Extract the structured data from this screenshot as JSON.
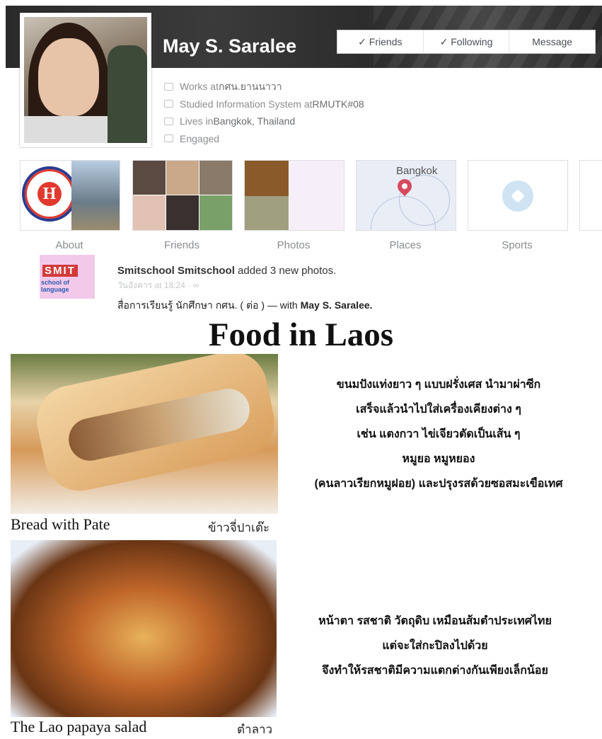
{
  "profile": {
    "name": "May S. Saralee",
    "buttons": {
      "friends": "✓ Friends",
      "following": "✓ Following",
      "message": "Message"
    },
    "info": [
      {
        "prefix": "Works at ",
        "value": "กศน.ยานนาวา"
      },
      {
        "prefix": "Studied Information System at ",
        "value": "RMUTK#08"
      },
      {
        "prefix": "Lives in ",
        "value": "Bangkok, Thailand"
      },
      {
        "prefix": "Engaged",
        "value": ""
      }
    ]
  },
  "tiles": {
    "about": "About",
    "friends": "Friends",
    "photos": "Photos",
    "places": "Places",
    "places_map": "Bangkok",
    "sports": "Sports"
  },
  "post": {
    "logo_text": "SMIT",
    "logo_sub": "school of language",
    "author": "Smitschool Smitschool",
    "action": " added 3 new photos.",
    "date": "วันอังคาร at 18:24 · ∞",
    "text": "สื่อการเรียนรู้ นักศึกษา กศน. ( ต่อ ) — with ",
    "tagged": "May S. Saralee."
  },
  "content": {
    "heading": "Food  in Laos",
    "food1": {
      "caption_en": "Bread with Pate",
      "caption_th": "ข้าวจี่ปาเต๊ะ",
      "description": [
        "ขนมปังแท่งยาว ๆ แบบฝรั่งเศส นำมาผ่าซีก",
        "เสร็จแล้วนำไปใส่เครื่องเคียงต่าง ๆ",
        "เช่น แตงกวา ไข่เจียวตัดเป็นเส้น ๆ",
        "หมูยอ หมูหยอง",
        "(คนลาวเรียกหมูฝอย) และปรุงรสด้วยซอสมะเขือเทศ"
      ]
    },
    "food2": {
      "caption_en": "The Lao papaya salad",
      "caption_th": "ตำลาว",
      "description": [
        "หน้าตา รสชาติ วัตถุดิบ เหมือนส้มตำประเทศไทย",
        "แต่จะใส่กะปิลงไปด้วย",
        "จึงทำให้รสชาติมีความแตกต่างกันเพียงเล็กน้อย"
      ]
    }
  }
}
